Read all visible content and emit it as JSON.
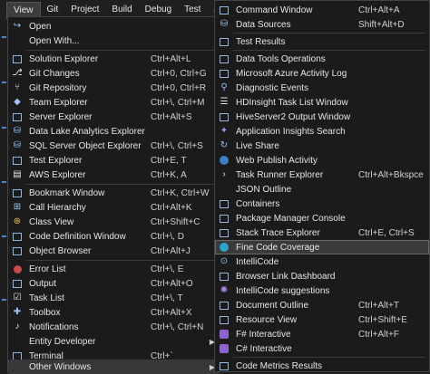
{
  "menubar": {
    "items": [
      "View",
      "Git",
      "Project",
      "Build",
      "Debug",
      "Test",
      "Analyz"
    ]
  },
  "view_menu": {
    "items": [
      {
        "label": "Open",
        "shortcut": "",
        "icon": "open-icon"
      },
      {
        "label": "Open With...",
        "shortcut": "",
        "icon": ""
      },
      {
        "label": "Solution Explorer",
        "shortcut": "Ctrl+Alt+L",
        "icon": "solution-explorer-icon"
      },
      {
        "label": "Git Changes",
        "shortcut": "Ctrl+0, Ctrl+G",
        "icon": "git-changes-icon"
      },
      {
        "label": "Git Repository",
        "shortcut": "Ctrl+0, Ctrl+R",
        "icon": "git-repository-icon"
      },
      {
        "label": "Team Explorer",
        "shortcut": "Ctrl+\\, Ctrl+M",
        "icon": "team-explorer-icon"
      },
      {
        "label": "Server Explorer",
        "shortcut": "Ctrl+Alt+S",
        "icon": "server-explorer-icon"
      },
      {
        "label": "Data Lake Analytics Explorer",
        "shortcut": "",
        "icon": "data-lake-icon"
      },
      {
        "label": "SQL Server Object Explorer",
        "shortcut": "Ctrl+\\, Ctrl+S",
        "icon": "sql-server-icon"
      },
      {
        "label": "Test Explorer",
        "shortcut": "Ctrl+E, T",
        "icon": "test-explorer-icon"
      },
      {
        "label": "AWS Explorer",
        "shortcut": "Ctrl+K, A",
        "icon": "aws-explorer-icon"
      },
      {
        "label": "Bookmark Window",
        "shortcut": "Ctrl+K, Ctrl+W",
        "icon": "bookmark-icon"
      },
      {
        "label": "Call Hierarchy",
        "shortcut": "Ctrl+Alt+K",
        "icon": "call-hierarchy-icon"
      },
      {
        "label": "Class View",
        "shortcut": "Ctrl+Shift+C",
        "icon": "class-view-icon"
      },
      {
        "label": "Code Definition Window",
        "shortcut": "Ctrl+\\, D",
        "icon": "code-definition-icon"
      },
      {
        "label": "Object Browser",
        "shortcut": "Ctrl+Alt+J",
        "icon": "object-browser-icon"
      },
      {
        "label": "Error List",
        "shortcut": "Ctrl+\\, E",
        "icon": "error-list-icon"
      },
      {
        "label": "Output",
        "shortcut": "Ctrl+Alt+O",
        "icon": "output-icon"
      },
      {
        "label": "Task List",
        "shortcut": "Ctrl+\\, T",
        "icon": "task-list-icon"
      },
      {
        "label": "Toolbox",
        "shortcut": "Ctrl+Alt+X",
        "icon": "toolbox-icon"
      },
      {
        "label": "Notifications",
        "shortcut": "Ctrl+\\, Ctrl+N",
        "icon": "notifications-icon"
      },
      {
        "label": "Entity Developer",
        "shortcut": "",
        "icon": ""
      },
      {
        "label": "Terminal",
        "shortcut": "Ctrl+`",
        "icon": "terminal-icon"
      },
      {
        "label": "Other Windows",
        "shortcut": "",
        "icon": ""
      }
    ]
  },
  "other_windows": {
    "items": [
      {
        "label": "Command Window",
        "shortcut": "Ctrl+Alt+A",
        "icon": "command-window-icon"
      },
      {
        "label": "Data Sources",
        "shortcut": "Shift+Alt+D",
        "icon": "data-sources-icon"
      },
      {
        "label": "Test Results",
        "shortcut": "",
        "icon": "test-results-icon"
      },
      {
        "label": "Data Tools Operations",
        "shortcut": "",
        "icon": "data-tools-icon"
      },
      {
        "label": "Microsoft Azure Activity Log",
        "shortcut": "",
        "icon": "azure-log-icon"
      },
      {
        "label": "Diagnostic Events",
        "shortcut": "",
        "icon": "diagnostic-icon"
      },
      {
        "label": "HDInsight Task List Window",
        "shortcut": "",
        "icon": "hdinsight-icon"
      },
      {
        "label": "HiveServer2 Output Window",
        "shortcut": "",
        "icon": "hiveserver-icon"
      },
      {
        "label": "Application Insights Search",
        "shortcut": "",
        "icon": "app-insights-icon"
      },
      {
        "label": "Live Share",
        "shortcut": "",
        "icon": "live-share-icon"
      },
      {
        "label": "Web Publish Activity",
        "shortcut": "",
        "icon": "web-publish-icon"
      },
      {
        "label": "Task Runner Explorer",
        "shortcut": "Ctrl+Alt+Bkspce",
        "icon": "task-runner-icon"
      },
      {
        "label": "JSON Outline",
        "shortcut": "",
        "icon": ""
      },
      {
        "label": "Containers",
        "shortcut": "",
        "icon": "containers-icon"
      },
      {
        "label": "Package Manager Console",
        "shortcut": "",
        "icon": "package-manager-icon"
      },
      {
        "label": "Stack Trace Explorer",
        "shortcut": "Ctrl+E, Ctrl+S",
        "icon": "stack-trace-icon"
      },
      {
        "label": "Fine Code Coverage",
        "shortcut": "",
        "icon": "fine-code-coverage-icon"
      },
      {
        "label": "IntelliCode",
        "shortcut": "",
        "icon": "intellicode-icon"
      },
      {
        "label": "Browser Link Dashboard",
        "shortcut": "",
        "icon": "browser-link-icon"
      },
      {
        "label": "IntelliCode suggestions",
        "shortcut": "",
        "icon": "intellicode-suggestions-icon"
      },
      {
        "label": "Document Outline",
        "shortcut": "Ctrl+Alt+T",
        "icon": "document-outline-icon"
      },
      {
        "label": "Resource View",
        "shortcut": "Ctrl+Shift+E",
        "icon": "resource-view-icon"
      },
      {
        "label": "F# Interactive",
        "shortcut": "Ctrl+Alt+F",
        "icon": "fsharp-icon"
      },
      {
        "label": "C# Interactive",
        "shortcut": "",
        "icon": "csharp-icon"
      },
      {
        "label": "Code Metrics Results",
        "shortcut": "",
        "icon": "code-metrics-icon"
      }
    ]
  }
}
